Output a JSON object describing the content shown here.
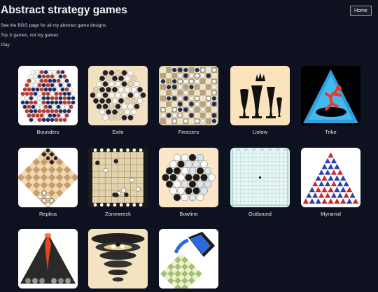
{
  "page": {
    "title": "Abstract strategy games",
    "home_label": "Home",
    "lines": [
      "See the BGG page for all my abstract game designs.",
      "Top X games, not my games",
      "Play:"
    ]
  },
  "games": [
    {
      "name": "Bounders",
      "icon": "bounders-board-icon"
    },
    {
      "name": "Exile",
      "icon": "exile-board-icon"
    },
    {
      "name": "Freezers",
      "icon": "freezers-board-icon"
    },
    {
      "name": "Lielow",
      "icon": "lielow-icon"
    },
    {
      "name": "Trike",
      "icon": "trike-icon"
    },
    {
      "name": "Replica",
      "icon": "replica-board-icon"
    },
    {
      "name": "Zonewreck",
      "icon": "zonewreck-board-icon"
    },
    {
      "name": "Bowline",
      "icon": "bowline-board-icon"
    },
    {
      "name": "Outbound",
      "icon": "outbound-board-icon"
    },
    {
      "name": "Myramid",
      "icon": "myramid-icon"
    },
    {
      "name": "",
      "icon": "volcano-icon"
    },
    {
      "name": "",
      "icon": "vortex-icon"
    },
    {
      "name": "",
      "icon": "pouring-icon"
    }
  ],
  "colors": {
    "background": "#0d1120",
    "text": "#e8e8ec"
  }
}
